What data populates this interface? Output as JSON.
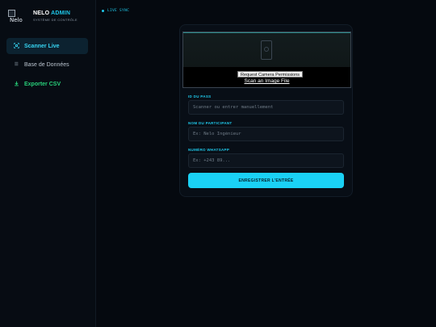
{
  "brand": {
    "logo_alt": "Nelo",
    "title_part1": "NELO",
    "title_part2": "ADMIN",
    "subtitle": "SYSTÈME DE CONTRÔLE"
  },
  "sidebar": {
    "items": [
      {
        "label": "Scanner Live",
        "icon": "qr-scan-icon",
        "active": true
      },
      {
        "label": "Base de Données",
        "icon": "list-icon",
        "active": false
      },
      {
        "label": "Exporter CSV",
        "icon": "download-icon",
        "active": false
      }
    ]
  },
  "topbar": {
    "status": "LIVE SYNC"
  },
  "scanner": {
    "permission_button": "Request Camera Permissions",
    "scan_file_link": "Scan an Image File"
  },
  "form": {
    "pass_label": "ID DU PASS",
    "pass_placeholder": "Scanner ou entrer manuellement",
    "name_label": "NOM DU PARTICIPANT",
    "name_placeholder": "Ex: Nelo Ingénieur",
    "whatsapp_label": "NUMÉRO WHATSAPP",
    "whatsapp_placeholder": "Ex: +243 89...",
    "submit_label": "ENREGISTRER L'ENTRÉE"
  },
  "colors": {
    "accent": "#1fc8ea",
    "export": "#28d07a",
    "background": "#05090f"
  }
}
